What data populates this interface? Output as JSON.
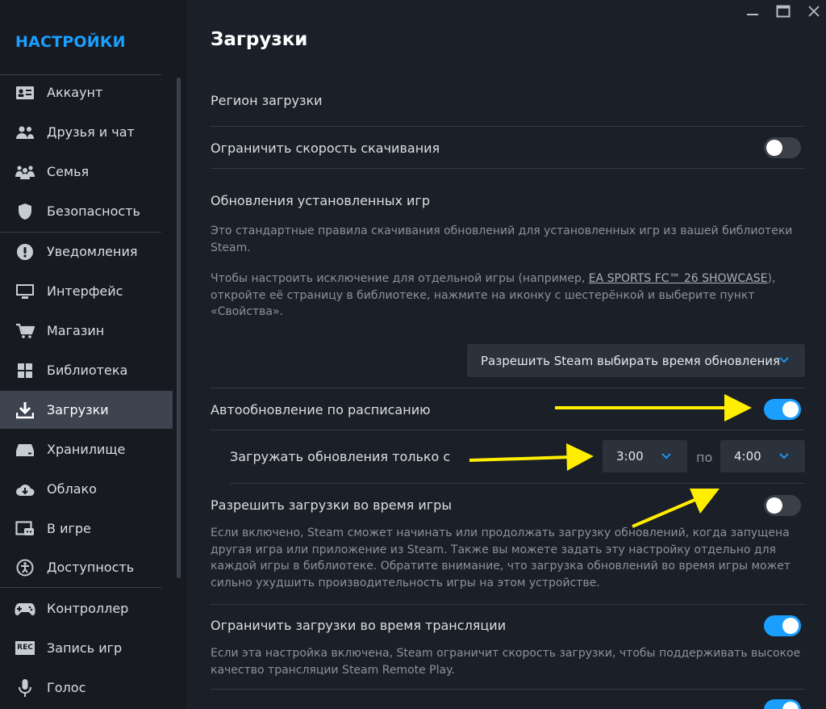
{
  "sidebar": {
    "title": "НАСТРОЙКИ",
    "items": [
      {
        "label": "Аккаунт",
        "icon": "account-card-icon"
      },
      {
        "label": "Друзья и чат",
        "icon": "friends-icon"
      },
      {
        "label": "Семья",
        "icon": "family-icon"
      },
      {
        "label": "Безопасность",
        "icon": "shield-icon"
      },
      {
        "label": "Уведомления",
        "icon": "notification-icon"
      },
      {
        "label": "Интерфейс",
        "icon": "monitor-icon"
      },
      {
        "label": "Магазин",
        "icon": "cart-icon"
      },
      {
        "label": "Библиотека",
        "icon": "library-grid-icon"
      },
      {
        "label": "Загрузки",
        "icon": "download-icon",
        "active": true
      },
      {
        "label": "Хранилище",
        "icon": "storage-drive-icon"
      },
      {
        "label": "Облако",
        "icon": "cloud-icon"
      },
      {
        "label": "В игре",
        "icon": "in-game-icon"
      },
      {
        "label": "Доступность",
        "icon": "accessibility-icon"
      },
      {
        "label": "Контроллер",
        "icon": "gamepad-icon"
      },
      {
        "label": "Запись игр",
        "icon": "rec-icon"
      },
      {
        "label": "Голос",
        "icon": "microphone-icon"
      }
    ],
    "rec_badge": "REC"
  },
  "main": {
    "title": "Загрузки",
    "region_label": "Регион загрузки",
    "limit_speed_label": "Ограничить скорость скачивания",
    "updates_heading": "Обновления установленных игр",
    "updates_desc_1": "Это стандартные правила скачивания обновлений для установленных игр из вашей библиотеки Steam.",
    "updates_desc_2_pre": "Чтобы настроить исключение для отдельной игры (например, ",
    "updates_desc_2_link": "EA SPORTS FC™ 26 SHOWCASE",
    "updates_desc_2_post": "), откройте её страницу в библиотеке, нажмите на иконку с шестерёнкой и выберите пункт «Свойства».",
    "update_policy_value": "Разрешить Steam выбирать время обновления",
    "schedule_label": "Автообновление по расписанию",
    "window_label": "Загружать обновления только с",
    "from_time": "3:00",
    "to_word": "по",
    "to_time": "4:00",
    "allow_ingame_label": "Разрешить загрузки во время игры",
    "allow_ingame_desc": "Если включено, Steam сможет начинать или продолжать загрузку обновлений, когда запущена другая игра или приложение из Steam. Также вы можете задать эту настройку отдельно для каждой игры в библиотеке. Обратите внимание, что загрузка обновлений во время игры может сильно ухудшить производительность игры на этом устройстве.",
    "limit_stream_label": "Ограничить загрузки во время трансляции",
    "limit_stream_desc": "Если эта настройка включена, Steam ограничит скорость загрузки, чтобы поддерживать высокое качество трансляции Steam Remote Play."
  },
  "toggles": {
    "limit_speed": false,
    "schedule": true,
    "allow_ingame": false,
    "limit_stream": true,
    "next_row": true
  },
  "colors": {
    "accent": "#1a9fff",
    "annotation_arrow": "#ffee00"
  }
}
